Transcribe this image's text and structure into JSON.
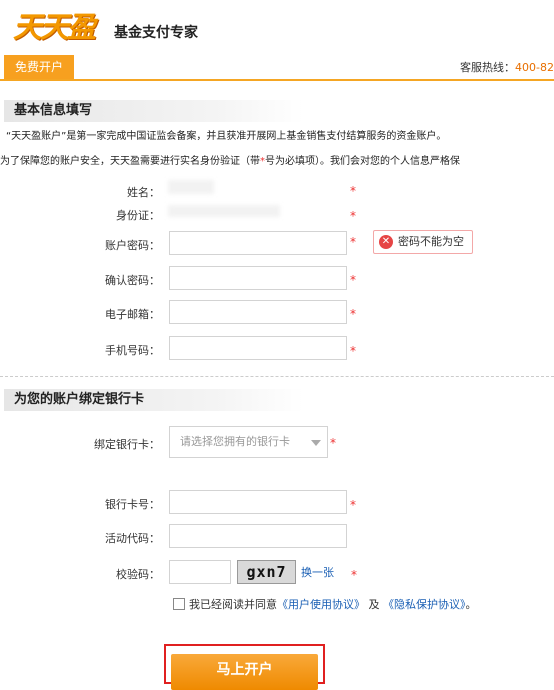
{
  "header": {
    "logo_text": "天天盈",
    "subtitle": "基金支付专家"
  },
  "nav": {
    "tab_label": "免费开户",
    "hotline_label": "客服热线：",
    "hotline_number": "400-82"
  },
  "section_basic": {
    "title": "基本信息填写",
    "intro_line1": "“天天盈账户”是第一家完成中国证监会备案，并且获准开展网上基金销售支付结算服务的资金账户。",
    "intro_line2_a": "为了保障您的账户安全，天天盈需要进行实名身份验证（带",
    "intro_line2_star": "*",
    "intro_line2_b": "号为必填项）。我们会对您的个人信息严格保"
  },
  "form_basic": {
    "name_label": "姓名：",
    "id_label": "身份证：",
    "password_label": "账户密码：",
    "confirm_label": "确认密码：",
    "email_label": "电子邮箱：",
    "phone_label": "手机号码：",
    "required_mark": "*",
    "password_error": "密码不能为空",
    "error_icon": "✕"
  },
  "section_bank": {
    "title": "为您的账户绑定银行卡"
  },
  "form_bank": {
    "bank_label": "绑定银行卡：",
    "bank_placeholder": "请选择您拥有的银行卡",
    "card_label": "银行卡号：",
    "promo_label": "活动代码：",
    "captcha_label": "校验码：",
    "captcha_text": "gxn7",
    "refresh_label": "换一张",
    "required_mark": "*"
  },
  "agreement": {
    "prefix": "我已经阅读并同意",
    "user_agreement": "《用户使用协议》",
    "and": "及",
    "privacy_agreement": "《隐私保护协议》",
    "suffix": "。"
  },
  "submit": {
    "label": "马上开户"
  }
}
